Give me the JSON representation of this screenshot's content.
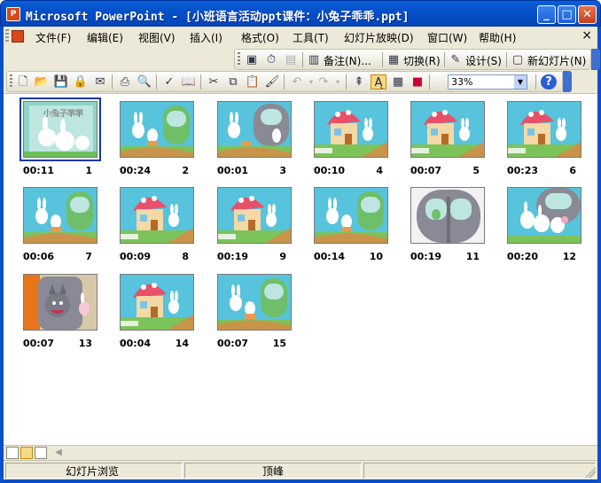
{
  "window": {
    "title": "Microsoft PowerPoint - [小班语言活动ppt课件：小兔子乖乖.ppt]",
    "app_icon": "powerpoint-icon",
    "min_label": "_",
    "max_label": "□",
    "close_label": "✕"
  },
  "menu": {
    "items": [
      "文件(F)",
      "编辑(E)",
      "视图(V)",
      "插入(I)",
      "格式(O)",
      "工具(T)",
      "幻灯片放映(D)",
      "窗口(W)",
      "帮助(H)"
    ],
    "close_label": "×"
  },
  "toolbar1": {
    "notes_label": "备注(N)...",
    "transition_label": "切换(R)",
    "design_label": "设计(S)",
    "new_slide_label": "新幻灯片(N)"
  },
  "toolbar2": {
    "zoom_value": "33%"
  },
  "slides": [
    {
      "number": "1",
      "time": "00:11",
      "scene": "title",
      "selected": true
    },
    {
      "number": "2",
      "time": "00:24",
      "scene": "door"
    },
    {
      "number": "3",
      "time": "00:01",
      "scene": "door-gray"
    },
    {
      "number": "4",
      "time": "00:10",
      "scene": "mushroom-house"
    },
    {
      "number": "5",
      "time": "00:07",
      "scene": "mushroom-house"
    },
    {
      "number": "6",
      "time": "00:23",
      "scene": "mushroom-house"
    },
    {
      "number": "7",
      "time": "00:06",
      "scene": "door"
    },
    {
      "number": "8",
      "time": "00:09",
      "scene": "mushroom-house"
    },
    {
      "number": "9",
      "time": "00:19",
      "scene": "mushroom-house"
    },
    {
      "number": "10",
      "time": "00:14",
      "scene": "door"
    },
    {
      "number": "11",
      "time": "00:19",
      "scene": "door-window"
    },
    {
      "number": "12",
      "time": "00:20",
      "scene": "door-rabbits"
    },
    {
      "number": "13",
      "time": "00:07",
      "scene": "wolf"
    },
    {
      "number": "14",
      "time": "00:04",
      "scene": "mushroom-house"
    },
    {
      "number": "15",
      "time": "00:07",
      "scene": "door"
    }
  ],
  "status": {
    "view_label": "幻灯片浏览",
    "design_label": "顶峰"
  }
}
